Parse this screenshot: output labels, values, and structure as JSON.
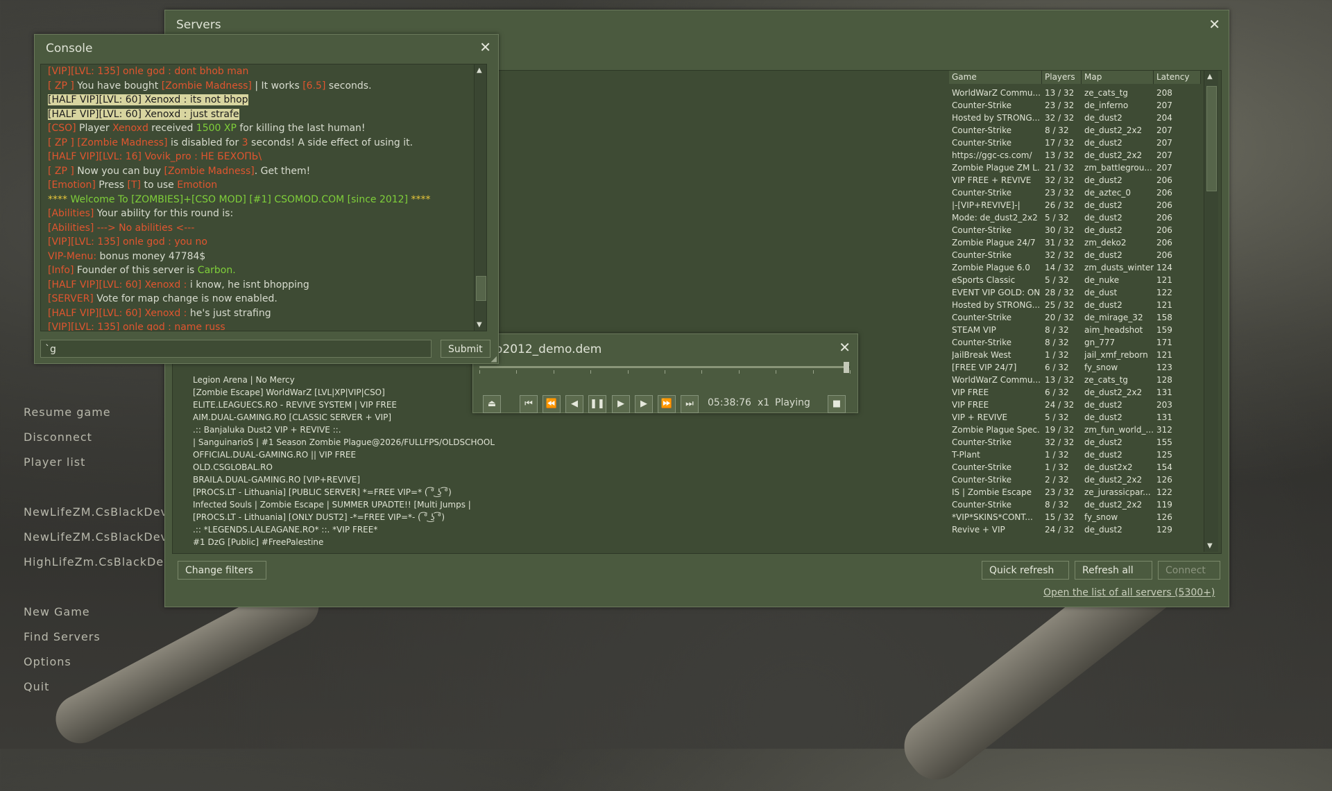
{
  "main_menu": {
    "resume": "Resume game",
    "disconnect": "Disconnect",
    "player_list": "Player list",
    "recent": [
      "NewLifeZM.CsBlackDev",
      "NewLifeZM.CsBlackDev",
      "HighLifeZm.CsBlackDev"
    ],
    "new_game": "New Game",
    "find_servers": "Find Servers",
    "options": "Options",
    "quit": "Quit"
  },
  "servers": {
    "title": "Servers",
    "close": "✕",
    "columns": {
      "game": "Game",
      "players": "Players",
      "map": "Map",
      "latency": "Latency"
    },
    "rows": [
      {
        "game": "WorldWarZ Commu...",
        "players": "13 / 32",
        "map": "ze_cats_tg",
        "latency": "208"
      },
      {
        "game": "Counter-Strike",
        "players": "23 / 32",
        "map": "de_inferno",
        "latency": "207"
      },
      {
        "game": "Hosted by STRONG...",
        "players": "32 / 32",
        "map": "de_dust2",
        "latency": "204"
      },
      {
        "game": "Counter-Strike",
        "players": "8 / 32",
        "map": "de_dust2_2x2",
        "latency": "207"
      },
      {
        "game": "Counter-Strike",
        "players": "17 / 32",
        "map": "de_dust2",
        "latency": "207"
      },
      {
        "game": "https://ggc-cs.com/",
        "players": "13 / 32",
        "map": "de_dust2_2x2",
        "latency": "207"
      },
      {
        "game": "Zombie Plague ZM L...",
        "players": "21 / 32",
        "map": "zm_battlegrou...",
        "latency": "207"
      },
      {
        "game": "VIP FREE + REVIVE",
        "players": "32 / 32",
        "map": "de_dust2",
        "latency": "206"
      },
      {
        "game": "Counter-Strike",
        "players": "23 / 32",
        "map": "de_aztec_0",
        "latency": "206"
      },
      {
        "game": "|-[VIP+REVIVE]-|",
        "players": "26 / 32",
        "map": "de_dust2",
        "latency": "206"
      },
      {
        "game": "Mode: de_dust2_2x2",
        "players": "5 / 32",
        "map": "de_dust2",
        "latency": "206"
      },
      {
        "game": "Counter-Strike",
        "players": "30 / 32",
        "map": "de_dust2",
        "latency": "206"
      },
      {
        "game": "Zombie Plague 24/7",
        "players": "31 / 32",
        "map": "zm_deko2",
        "latency": "206"
      },
      {
        "game": "Counter-Strike",
        "players": "32 / 32",
        "map": "de_dust2",
        "latency": "206"
      },
      {
        "game": "Zombie Plague 6.0",
        "players": "14 / 32",
        "map": "zm_dusts_winter",
        "latency": "124"
      },
      {
        "game": "eSports Classic",
        "players": "5 / 32",
        "map": "de_nuke",
        "latency": "121"
      },
      {
        "game": "EVENT VIP GOLD: ON",
        "players": "28 / 32",
        "map": "de_dust",
        "latency": "122"
      },
      {
        "game": "Hosted by STRONG...",
        "players": "25 / 32",
        "map": "de_dust2",
        "latency": "121"
      },
      {
        "game": "Counter-Strike",
        "players": "20 / 32",
        "map": "de_mirage_32",
        "latency": "158"
      },
      {
        "game": "STEAM VIP",
        "players": "8 / 32",
        "map": "aim_headshot",
        "latency": "159"
      },
      {
        "game": "Counter-Strike",
        "players": "8 / 32",
        "map": "gn_777",
        "latency": "171"
      },
      {
        "game": "JailBreak West",
        "players": "1 / 32",
        "map": "jail_xmf_reborn",
        "latency": "121"
      },
      {
        "game": "[FREE VIP 24/7]",
        "players": "6 / 32",
        "map": "fy_snow",
        "latency": "123"
      },
      {
        "game": "WorldWarZ Commu...",
        "players": "13 / 32",
        "map": "ze_cats_tg",
        "latency": "128"
      },
      {
        "game": "VIP FREE",
        "players": "6 / 32",
        "map": "de_dust2_2x2",
        "latency": "131"
      },
      {
        "game": "VIP FREE",
        "players": "24 / 32",
        "map": "de_dust2",
        "latency": "203"
      },
      {
        "game": "VIP + REVIVE",
        "players": "5 / 32",
        "map": "de_dust2",
        "latency": "131"
      },
      {
        "game": "Zombie Plague Spec...",
        "players": "19 / 32",
        "map": "zm_fun_world_...",
        "latency": "312"
      },
      {
        "game": "Counter-Strike",
        "players": "32 / 32",
        "map": "de_dust2",
        "latency": "155"
      },
      {
        "game": "T-Plant",
        "players": "1 / 32",
        "map": "de_dust2",
        "latency": "125"
      },
      {
        "game": "Counter-Strike",
        "players": "1 / 32",
        "map": "de_dust2x2",
        "latency": "154"
      },
      {
        "game": "Counter-Strike",
        "players": "2 / 32",
        "map": "de_dust2_2x2",
        "latency": "126"
      },
      {
        "game": "IS | Zombie Escape",
        "players": "23 / 32",
        "map": "ze_jurassicpar...",
        "latency": "122"
      },
      {
        "game": "Counter-Strike",
        "players": "8 / 32",
        "map": "de_dust2_2x2",
        "latency": "119"
      },
      {
        "game": "*VIP*SKINS*CONT...",
        "players": "15 / 32",
        "map": "fy_snow",
        "latency": "126"
      },
      {
        "game": "Revive + VIP",
        "players": "24 / 32",
        "map": "de_dust2",
        "latency": "129"
      }
    ],
    "names": [
      "Legion Arena | No Mercy",
      "[Zombie Escape] WorldWarZ [LVL|XP|VIP|CSO]",
      "ELITE.LEAGUECS.RO - REVIVE SYSTEM | VIP FREE",
      "AIM.DUAL-GAMING.RO [CLASSIC SERVER + VIP]",
      ".:: Banjaluka Dust2 VIP + REVIVE ::.",
      "| SanguinarioS | #1 Season Zombie Plague@2026/FULLFPS/OLDSCHOOL",
      "OFFICIAL.DUAL-GAMING.RO || VIP FREE",
      "OLD.CSGLOBAL.RO",
      "BRAILA.DUAL-GAMING.RO [VIP+REVIVE]",
      "[PROCS.LT - Lithuania] [PUBLIC SERVER] *=FREE VIP=* ( ͡° ͜ʖ ͡°)",
      "Infected Souls | Zombie Escape | SUMMER UPADTE!! [Multi Jumps |",
      "[PROCS.LT - Lithuania] [ONLY DUST2] -*=FREE VIP=*- ( ͡° ͜ʖ ͡°)",
      ".:: *LEGENDS.LALEAGANE.RO* ::. *VIP FREE*",
      "#1 DzG [Public] #FreePalestine"
    ],
    "change_filters": "Change filters",
    "quick_refresh": "Quick refresh",
    "refresh_all": "Refresh all",
    "connect": "Connect",
    "open_list": "Open the list of all servers (5300+)"
  },
  "console": {
    "title": "Console",
    "close": "✕",
    "input_value": "`g",
    "submit": "Submit",
    "lines": [
      [
        [
          "r",
          "[VIP][LVL: 135] onle god : dont bhob man"
        ]
      ],
      [
        [
          "r",
          "[ ZP ]"
        ],
        [
          "w",
          " You have bought "
        ],
        [
          "r",
          "[Zombie Madness]"
        ],
        [
          "w",
          " | It works "
        ],
        [
          "r",
          "[6.5]"
        ],
        [
          "w",
          " seconds."
        ]
      ],
      [
        [
          "hl",
          "[HALF VIP][LVL: 60] Xenoxd : its not bhop"
        ]
      ],
      [
        [
          "hl",
          "[HALF VIP][LVL: 60] Xenoxd : just strafe"
        ]
      ],
      [
        [
          "r",
          "[CSO]"
        ],
        [
          "w",
          " Player "
        ],
        [
          "r",
          "Xenoxd"
        ],
        [
          "w",
          " received "
        ],
        [
          "g",
          "1500 XP"
        ],
        [
          "w",
          " for killing the last human!"
        ]
      ],
      [
        [
          "r",
          "[ ZP ]"
        ],
        [
          "w",
          " "
        ],
        [
          "r",
          "[Zombie Madness]"
        ],
        [
          "w",
          " is disabled for "
        ],
        [
          "r",
          "3"
        ],
        [
          "w",
          " seconds! A side effect of using it."
        ]
      ],
      [
        [
          "r",
          "[HALF VIP][LVL: 16] Vovik_pro : НЕ БЕХОПЬ\\"
        ]
      ],
      [
        [
          "r",
          "[ ZP ]"
        ],
        [
          "w",
          " Now you can buy "
        ],
        [
          "r",
          "[Zombie Madness]"
        ],
        [
          "w",
          ". Get them!"
        ]
      ],
      [
        [
          "r",
          "[Emotion]"
        ],
        [
          "w",
          " Press "
        ],
        [
          "r",
          "[T]"
        ],
        [
          "w",
          " to use "
        ],
        [
          "r",
          "Emotion"
        ]
      ],
      [
        [
          "y",
          "****"
        ],
        [
          "g",
          " Welcome To [ZOMBIES]+[CSO MOD] [#1] CSOMOD.COM [since 2012] "
        ],
        [
          "y",
          "****"
        ]
      ],
      [
        [
          "r",
          "[Abilities]"
        ],
        [
          "w",
          " Your ability for this round is:"
        ]
      ],
      [
        [
          "r",
          "[Abilities] ---> No abilities <---"
        ]
      ],
      [
        [
          "r",
          "[VIP][LVL: 135] onle god : you no"
        ]
      ],
      [
        [
          "r",
          "VIP-Menu:"
        ],
        [
          "w",
          " bonus money 47784$"
        ]
      ],
      [
        [
          "r",
          "[Info]"
        ],
        [
          "w",
          " Founder of this server is "
        ],
        [
          "g",
          "Carbon."
        ]
      ],
      [
        [
          "r",
          "[HALF VIP][LVL: 60] Xenoxd : "
        ],
        [
          "w",
          "i know, he isnt bhopping"
        ]
      ],
      [
        [
          "r",
          "[SERVER]"
        ],
        [
          "w",
          " Vote for map change is now enabled."
        ]
      ],
      [
        [
          "r",
          "[HALF VIP][LVL: 60] Xenoxd : "
        ],
        [
          "w",
          "he's just strafing"
        ]
      ],
      [
        [
          "r",
          "[VIP][LVL: 135] onle god : name russ"
        ]
      ]
    ]
  },
  "demo": {
    "filename": "o2012_demo.dem",
    "close": "✕",
    "time": "05:38:76",
    "speed": "x1",
    "state": "Playing",
    "progress": 0.99
  },
  "colors": {
    "panel": "#4b5a3f",
    "inner": "#3e4b34",
    "red": "#e0552f",
    "green": "#7fcf3a"
  }
}
